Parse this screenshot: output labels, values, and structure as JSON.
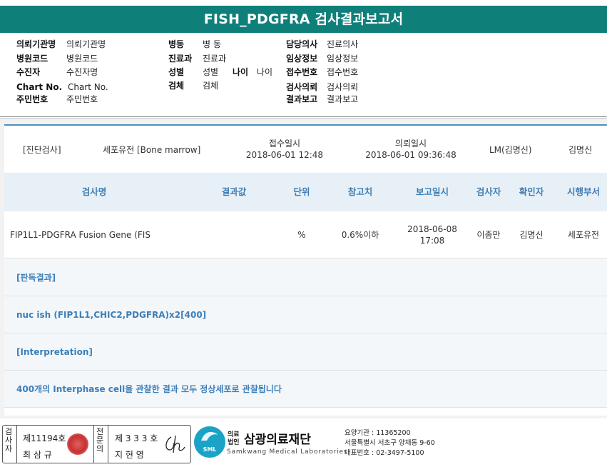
{
  "report_title": "FISH_PDGFRA 검사결과보고서",
  "patient": {
    "col1": [
      {
        "key": "의뢰기관명",
        "value": "의뢰기관명"
      },
      {
        "key": "병원코드",
        "value": "병원코드"
      },
      {
        "key": "수진자",
        "value": "수진자명"
      },
      {
        "key": "Chart No.",
        "value": "Chart No."
      },
      {
        "key": "주민번호",
        "value": "주민번호"
      }
    ],
    "col2": [
      {
        "key": "병동",
        "value": "병 동"
      },
      {
        "key": "진료과",
        "value": "진료과"
      },
      {
        "key": "성별",
        "value": "성별"
      },
      {
        "key": "검체",
        "value": "검체"
      }
    ],
    "age": {
      "key": "나이",
      "value": "나이"
    },
    "col3": [
      {
        "key": "담당의사",
        "value": "진료의사"
      },
      {
        "key": "임상정보",
        "value": "임상정보"
      },
      {
        "key": "접수번호",
        "value": "접수번호"
      },
      {
        "key": "검사의뢰",
        "value": "검사의뢰"
      },
      {
        "key": "결과보고",
        "value": "결과보고"
      }
    ]
  },
  "summary": {
    "category": "[진단검사]",
    "department": "세포유전 [Bone marrow]",
    "received_label": "접수일시",
    "received_value": "2018-06-01 12:48",
    "requested_label": "의뢰일시",
    "requested_value": "2018-06-01 09:36:48",
    "lm": "LM(김명신)",
    "confirmer": "김명신"
  },
  "table": {
    "headers": [
      "검사명",
      "결과값",
      "단위",
      "참고치",
      "보고일시",
      "검사자",
      "확인자",
      "시행부서"
    ],
    "row": {
      "test_name": "FIP1L1-PDGFRA Fusion Gene (FIS",
      "result": "",
      "unit": "%",
      "reference": "0.6%이하",
      "report_date": "2018-06-08",
      "report_time": "17:08",
      "tester": "이종만",
      "confirmer": "김명신",
      "department": "세포유전"
    }
  },
  "results": [
    "[판독결과]",
    "nuc ish (FIP1L1,CHIC2,PDGFRA)x2[400]",
    "[Interpretation]",
    "400개의 Interphase cell을 관찰한 결과  모두 정상세포로 관찰됩니다"
  ],
  "footer": {
    "tester_label": "검사자",
    "tester_no": "제11194호",
    "tester_name": "최 삼 규",
    "specialist_label": "전문의",
    "specialist_no": "제 3 3 3 호",
    "specialist_name": "지 현 영",
    "logo_text": "SML",
    "org_prefix_top": "의료",
    "org_prefix_bottom": "법인",
    "org_name": "삼광의료재단",
    "org_english": "Samkwang Medical Laboratories",
    "org_code": "요양기관 : 11365200",
    "org_address": "서울특별시 서초구 양재동 9-60",
    "org_phone": "대표번호 : 02-3497-5100"
  },
  "colors": {
    "title_bar": "#0f7f7a",
    "accent_blue": "#3e7eb5",
    "header_bg": "#e8f0f7",
    "logo": "#1aa3c6"
  }
}
